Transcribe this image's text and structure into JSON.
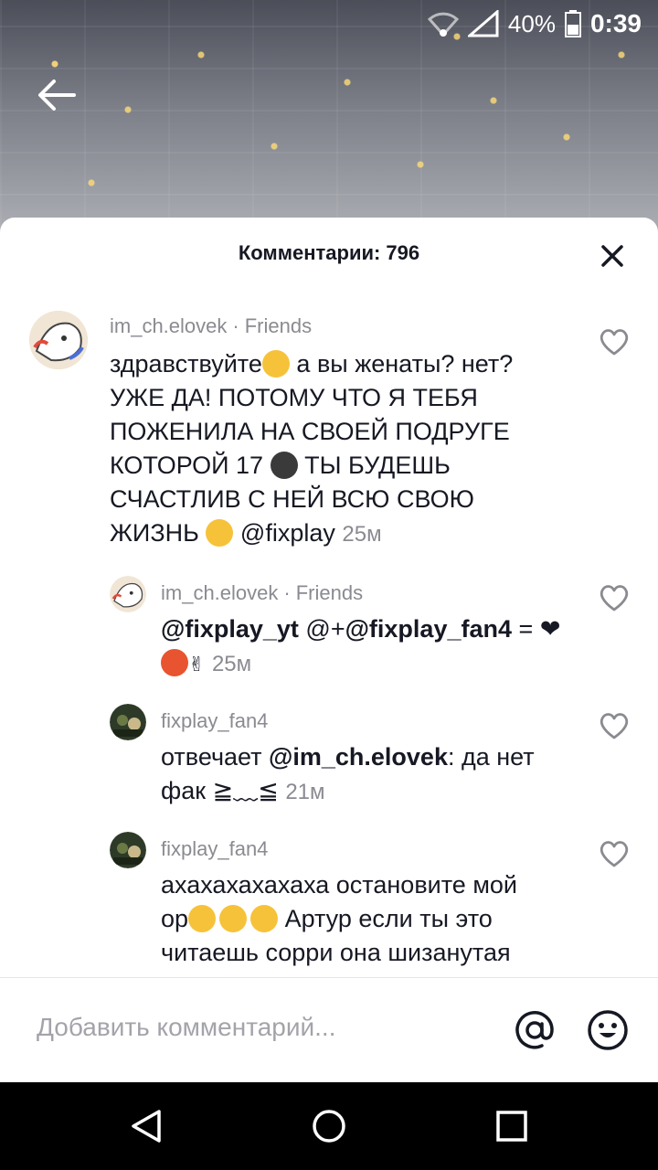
{
  "status": {
    "battery": "40%",
    "time": "0:39"
  },
  "sheet": {
    "title": "Комментарии: 796"
  },
  "comments": [
    {
      "username": "im_ch.elovek",
      "tag": "Friends",
      "text_lines": [
        "здравствуйте",
        "а вы женаты? нет?",
        "УЖЕ ДА! ПОТОМУ ЧТО Я ТЕБЯ",
        "ПОЖЕНИЛА НА СВОЕЙ ПОДРУГЕ",
        "КОТОРОЙ 17",
        "ТЫ БУДЕШЬ",
        "СЧАСТЛИВ С НЕЙ ВСЮ СВОЮ",
        "ЖИЗНЬ"
      ],
      "mention": "@fixplay",
      "time": "25м"
    },
    {
      "username": "im_ch.elovek",
      "tag": "Friends",
      "mention1": "@fixplay_yt",
      "mid": "@+",
      "mention2": "@fixplay_fan4",
      "tail": "=",
      "heart": "❤",
      "hand": "✌",
      "time": "25м"
    },
    {
      "username": "fixplay_fan4",
      "prefix": "отвечает",
      "mention": "@im_ch.elovek",
      "text": ": да нет",
      "line2": "фак ≧﹏≦",
      "time": "21м"
    },
    {
      "username": "fixplay_fan4",
      "line1": "ахахахахахаха остановите мой",
      "line2a": "ор",
      "line2b": "Артур если ты это",
      "line3": "читаешь сорри она шизанутая"
    }
  ],
  "input": {
    "placeholder": "Добавить комментарий..."
  },
  "colors": {
    "accent": "#161823",
    "muted": "#8a8b91"
  }
}
